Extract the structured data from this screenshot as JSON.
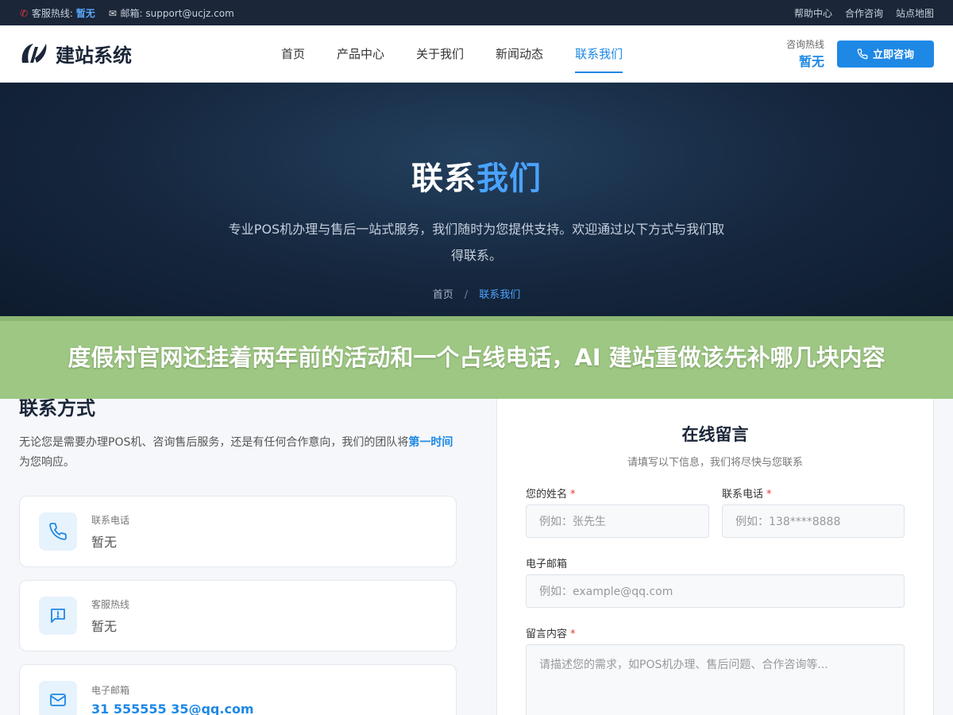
{
  "topbar": {
    "hotline_label": "客服热线:",
    "hotline_value": "暂无",
    "email_label": "邮箱:",
    "email_value": "support@ucjz.com",
    "links": [
      "帮助中心",
      "合作咨询",
      "站点地图"
    ]
  },
  "header": {
    "logo_text": "建站系统",
    "nav": [
      "首页",
      "产品中心",
      "关于我们",
      "新闻动态",
      "联系我们"
    ],
    "active_nav": "联系我们",
    "hotline_label": "咨询热线",
    "hotline_value": "暂无",
    "consult_button": "立即咨询"
  },
  "hero": {
    "title_a": "联系",
    "title_b": "我们",
    "desc": "专业POS机办理与售后一站式服务，我们随时为您提供支持。欢迎通过以下方式与我们取得联系。",
    "crumb_home": "首页",
    "crumb_sep": "/",
    "crumb_current": "联系我们"
  },
  "banner": {
    "text": "度假村官网还挂着两年前的活动和一个占线电话，AI 建站重做该先补哪几块内容"
  },
  "contact": {
    "title": "联系方式",
    "intro_a": "无论您是需要办理POS机、咨询售后服务，还是有任何合作意向，我们的团队将",
    "intro_hl": "第一时间",
    "intro_b": "为您响应。",
    "cards": [
      {
        "label": "联系电话",
        "value": "暂无",
        "icon": "phone-icon"
      },
      {
        "label": "客服热线",
        "value": "暂无",
        "icon": "message-icon"
      },
      {
        "label": "电子邮箱",
        "value": "31 555555 35@qq.com",
        "icon": "mail-icon"
      }
    ]
  },
  "form": {
    "title": "在线留言",
    "subtitle": "请填写以下信息，我们将尽快与您联系",
    "name_label": "您的姓名",
    "name_placeholder": "例如：张先生",
    "phone_label": "联系电话",
    "phone_placeholder": "例如：138****8888",
    "email_label": "电子邮箱",
    "email_placeholder": "例如：example@qq.com",
    "message_label": "留言内容",
    "message_placeholder": "请描述您的需求，如POS机办理、售后问题、合作咨询等...",
    "required_mark": "*"
  },
  "colors": {
    "accent": "#1e88e5",
    "dark": "#1b2638",
    "banner": "#96c378"
  }
}
